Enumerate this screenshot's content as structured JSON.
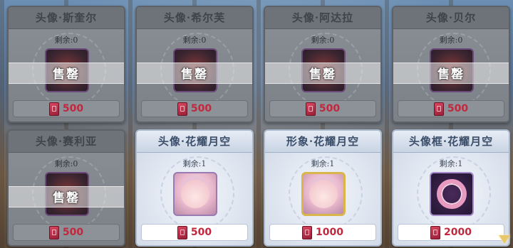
{
  "shop": {
    "items": [
      {
        "title": "头像·斯奎尔",
        "remain": "剩余:0",
        "price": "500",
        "sold": true,
        "sold_label": "售罄"
      },
      {
        "title": "头像·希尔芙",
        "remain": "剩余:0",
        "price": "500",
        "sold": true,
        "sold_label": "售罄"
      },
      {
        "title": "头像·阿达拉",
        "remain": "剩余:0",
        "price": "500",
        "sold": true,
        "sold_label": "售罄"
      },
      {
        "title": "头像·贝尔",
        "remain": "剩余:0",
        "price": "500",
        "sold": true,
        "sold_label": "售罄"
      },
      {
        "title": "头像·赛利亚",
        "remain": "剩余:0",
        "price": "500",
        "sold": true,
        "sold_label": "售罄"
      },
      {
        "title": "头像·花耀月空",
        "remain": "剩余:1",
        "price": "500",
        "sold": false
      },
      {
        "title": "形象·花耀月空",
        "remain": "剩余:1",
        "price": "1000",
        "sold": false
      },
      {
        "title": "头像框·花耀月空",
        "remain": "剩余:1",
        "price": "2000",
        "sold": false
      }
    ]
  },
  "colors": {
    "price": "#c0283e",
    "sold_header": "#6e737a",
    "avail_header": "#c9d4e4"
  }
}
